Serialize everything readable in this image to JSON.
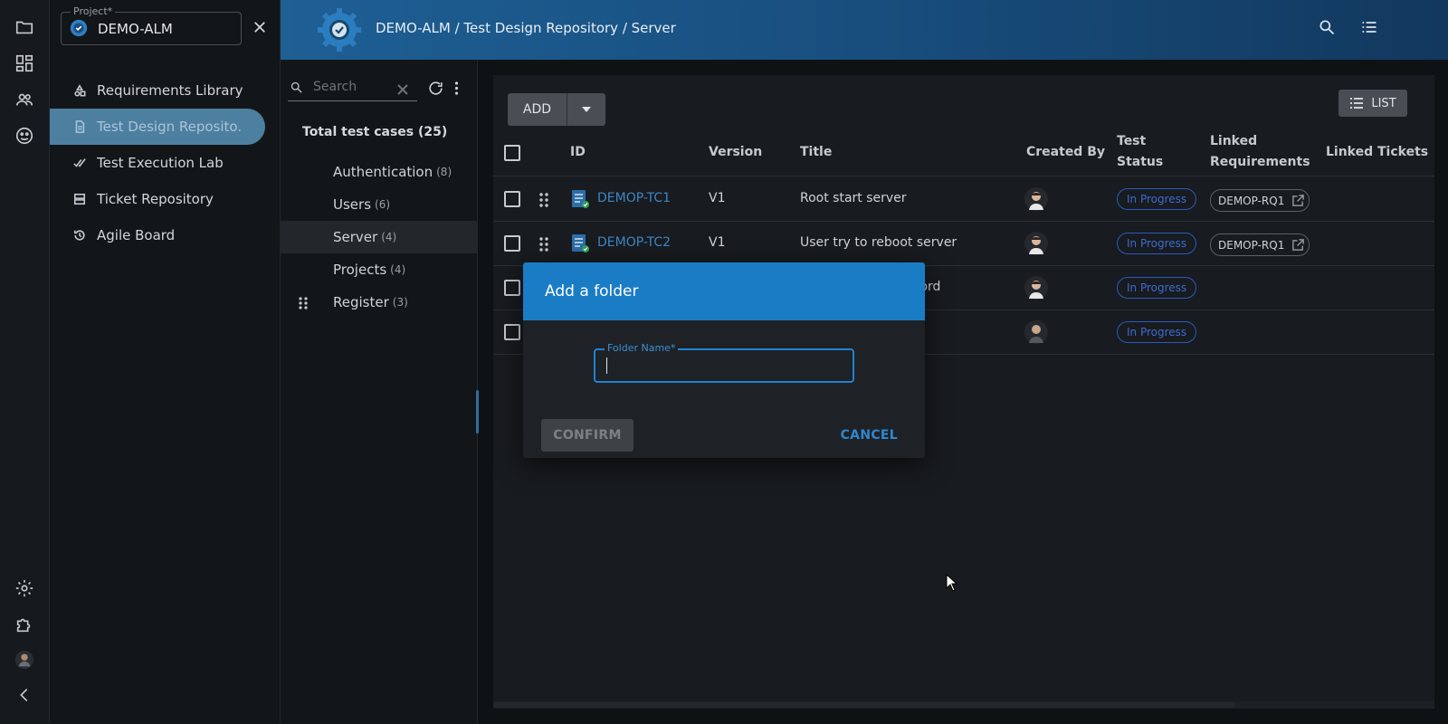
{
  "project": {
    "label": "Project*",
    "value": "DEMO-ALM"
  },
  "nav": {
    "items": [
      {
        "label": "Requirements Library",
        "icon": "shapes-icon"
      },
      {
        "label": "Test Design Reposito.",
        "icon": "document-icon",
        "active": true
      },
      {
        "label": "Test Execution Lab",
        "icon": "double-check-icon"
      },
      {
        "label": "Ticket Repository",
        "icon": "storage-icon"
      },
      {
        "label": "Agile Board",
        "icon": "history-icon"
      }
    ]
  },
  "header": {
    "breadcrumb": "DEMO-ALM / Test Design Repository / Server"
  },
  "tree": {
    "search_placeholder": "Search",
    "total": "Total test cases (25)",
    "folders": [
      {
        "name": "Authentication",
        "count": "(8)"
      },
      {
        "name": "Users",
        "count": "(6)"
      },
      {
        "name": "Server",
        "count": "(4)",
        "active": true
      },
      {
        "name": "Projects",
        "count": "(4)"
      },
      {
        "name": "Register",
        "count": "(3)"
      }
    ]
  },
  "toolbar": {
    "add_label": "ADD",
    "list_label": "LIST"
  },
  "table": {
    "headers": {
      "id": "ID",
      "version": "Version",
      "title": "Title",
      "created_by": "Created By",
      "test_status_1": "Test",
      "test_status_2": "Status",
      "linked_req_1": "Linked",
      "linked_req_2": "Requirements",
      "linked_tickets": "Linked Tickets"
    },
    "rows": [
      {
        "id": "DEMOP-TC1",
        "version": "V1",
        "title": "Root start server",
        "status": "In Progress",
        "req": "DEMOP-RQ1"
      },
      {
        "id": "DEMOP-TC2",
        "version": "V1",
        "title": "User try to reboot server",
        "status": "In Progress",
        "req": "DEMOP-RQ1"
      },
      {
        "id": "",
        "version": "",
        "title": "word",
        "status": "In Progress",
        "req": ""
      },
      {
        "id": "",
        "version": "",
        "title": "",
        "status": "In Progress",
        "req": ""
      }
    ]
  },
  "dialog": {
    "title": "Add a folder",
    "field_label": "Folder Name*",
    "field_value": "",
    "confirm": "CONFIRM",
    "cancel": "CANCEL"
  },
  "colors": {
    "accent": "#1b7cc6",
    "header_gradient_start": "#1e5f94",
    "status_border": "#2b5ac0",
    "link": "#3f86c3",
    "active_nav": "#4d7fa0"
  }
}
